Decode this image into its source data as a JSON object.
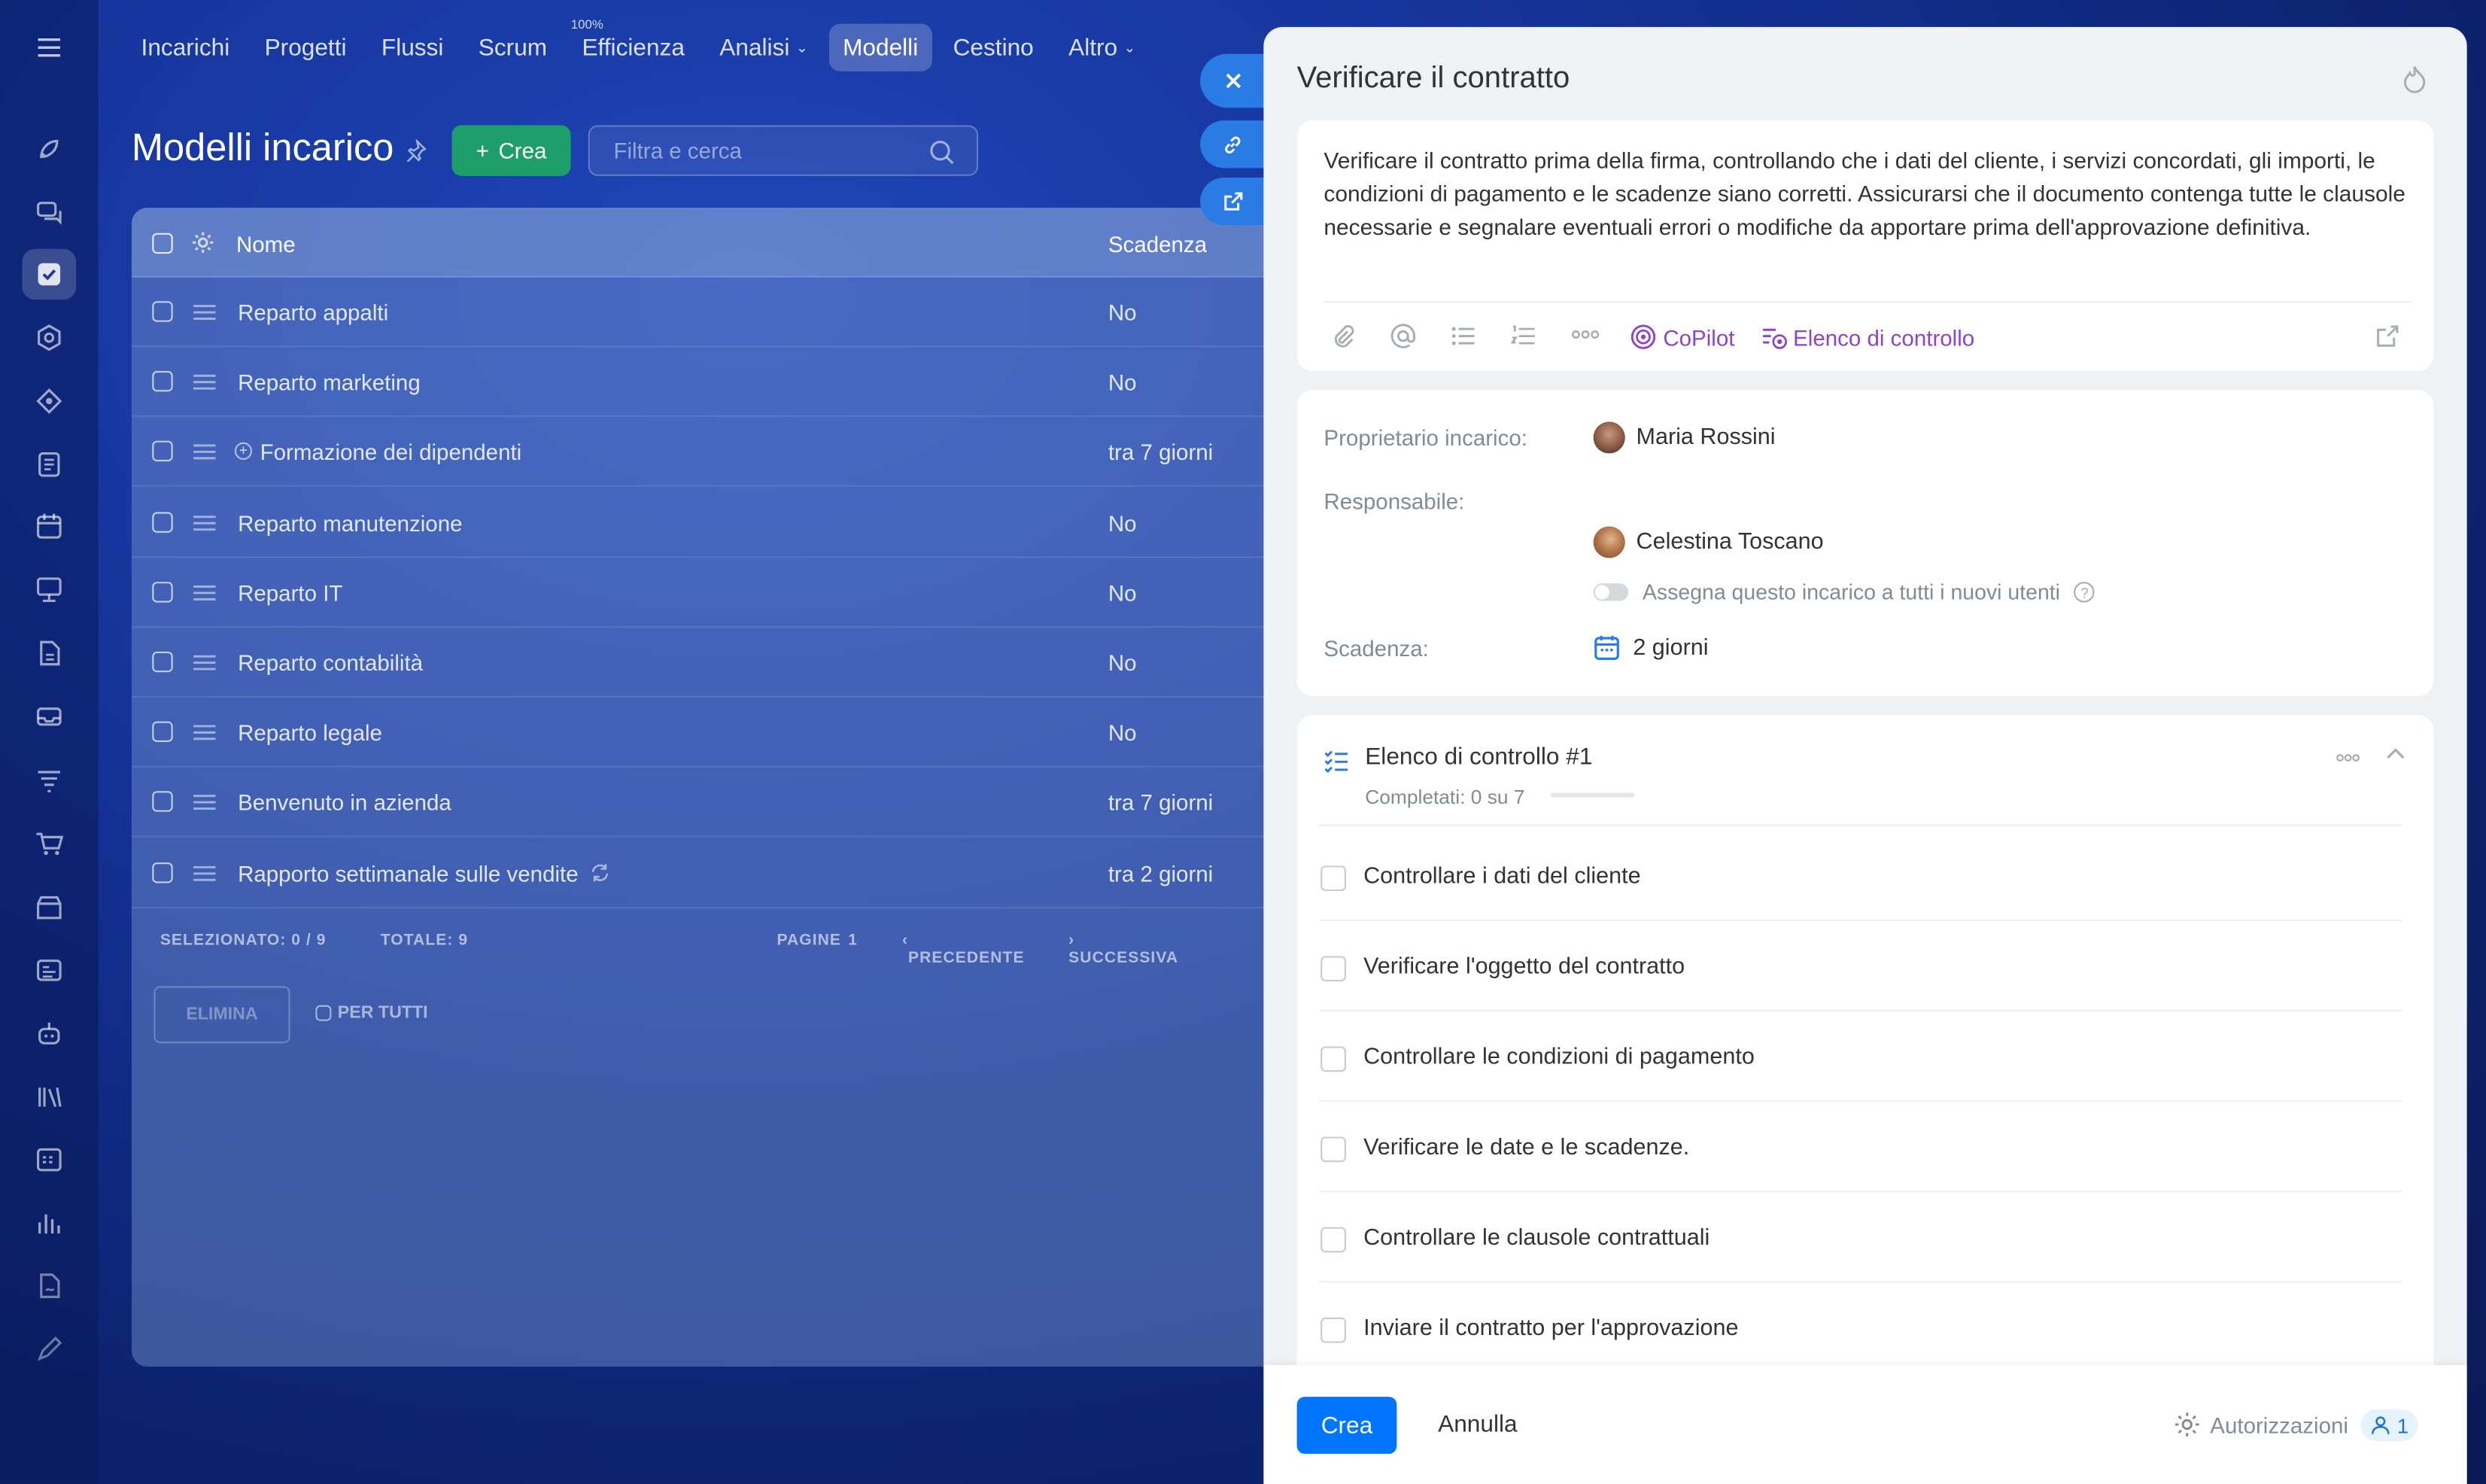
{
  "nav": {
    "items": [
      {
        "label": "Incarichi",
        "active": false
      },
      {
        "label": "Progetti",
        "active": false
      },
      {
        "label": "Flussi",
        "active": false
      },
      {
        "label": "Scrum",
        "active": false
      },
      {
        "label": "Efficienza",
        "sup": "100%",
        "active": false
      },
      {
        "label": "Analisi",
        "caret": true,
        "active": false
      },
      {
        "label": "Modelli",
        "active": true
      },
      {
        "label": "Cestino",
        "active": false
      },
      {
        "label": "Altro",
        "caret": true,
        "active": false
      }
    ]
  },
  "sidebar": {
    "icons": [
      "menu-icon",
      "rocket-icon",
      "chat-icon",
      "tasks-icon",
      "hexagon-icon",
      "crm-icon",
      "document-icon",
      "calendar-icon",
      "presentation-icon",
      "file-icon",
      "inbox-icon",
      "filter-icon",
      "cart-icon",
      "store-icon",
      "contact-card-icon",
      "robot-icon",
      "library-icon",
      "schedule-icon",
      "analytics-icon",
      "sign-icon",
      "pen-icon"
    ],
    "active_index": 3
  },
  "page": {
    "title": "Modelli incarico",
    "create_label": "Crea",
    "search_placeholder": "Filtra e cerca"
  },
  "grid": {
    "columns": {
      "name": "Nome",
      "due": "Scadenza"
    },
    "rows": [
      {
        "name": "Reparto appalti",
        "due": "No"
      },
      {
        "name": "Reparto marketing",
        "due": "No"
      },
      {
        "name": "Formazione dei dipendenti",
        "due": "tra 7 giorni",
        "subtask": true
      },
      {
        "name": "Reparto manutenzione",
        "due": "No"
      },
      {
        "name": "Reparto IT",
        "due": "No"
      },
      {
        "name": "Reparto contabilità",
        "due": "No"
      },
      {
        "name": "Reparto legale",
        "due": "No"
      },
      {
        "name": "Benvenuto in azienda",
        "due": "tra 7 giorni"
      },
      {
        "name": "Rapporto settimanale sulle vendite",
        "due": "tra 2 giorni",
        "recurring": true
      }
    ],
    "footer": {
      "selected": "SELEZIONATO: 0 / 9",
      "total": "TOTALE: 9",
      "pages": "PAGINE",
      "page_num": "1",
      "prev": "PRECEDENTE",
      "next": "SUCCESSIVA"
    },
    "actions": {
      "delete": "ELIMINA",
      "for_all": "PER TUTTI"
    }
  },
  "panel": {
    "title": "Verificare il contratto",
    "description": "Verificare il contratto prima della firma, controllando che i dati del cliente, i servizi concordati, gli importi, le condizioni di pagamento e le scadenze siano corretti. Assicurarsi che il documento contenga tutte le clausole necessarie e segnalare eventuali errori o modifiche da apportare prima dell'approvazione definitiva.",
    "toolbar": {
      "copilot": "CoPilot",
      "checklist": "Elenco di controllo"
    },
    "fields": {
      "owner_label": "Proprietario incarico:",
      "owner": "Maria Rossini",
      "responsible_label": "Responsabile:",
      "responsible": "Celestina Toscano",
      "assign_all": "Assegna questo incarico a tutti i nuovi utenti",
      "due_label": "Scadenza:",
      "due": "2 giorni"
    },
    "checklist": {
      "title": "Elenco di controllo #1",
      "completed": "Completati: 0 su 7",
      "progress": 0,
      "items": [
        "Controllare i dati del cliente",
        "Verificare l'oggetto del contratto",
        "Controllare le condizioni di pagamento",
        "Verificare le date e le scadenze.",
        "Controllare le clausole contrattuali",
        "Inviare il contratto per l'approvazione"
      ]
    },
    "footer": {
      "create": "Crea",
      "cancel": "Annulla",
      "permissions": "Autorizzazioni",
      "permissions_count": "1"
    }
  },
  "colors": {
    "primary": "#0075ff",
    "green": "#1e9e6a",
    "copilot": "#8e44c9",
    "background": "#15339a"
  }
}
